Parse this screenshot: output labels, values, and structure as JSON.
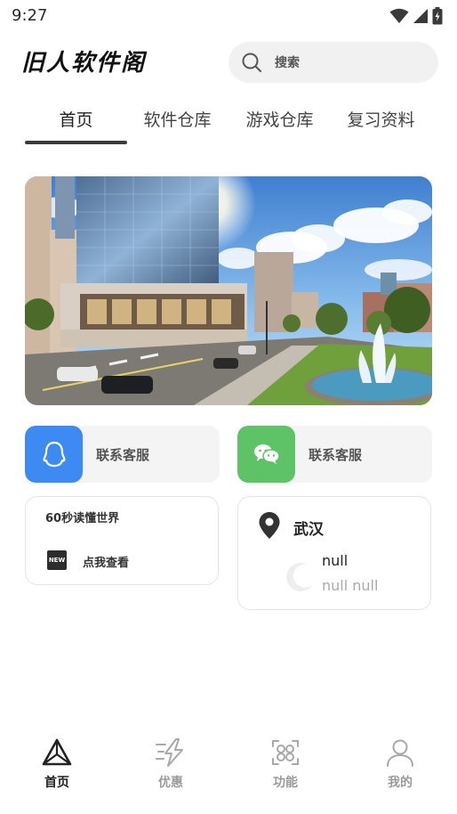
{
  "status_bar": {
    "time": "9:27",
    "icons": [
      "wifi-icon",
      "signal-icon",
      "battery-charging-icon"
    ]
  },
  "header": {
    "logo_text": "旧人软件阁",
    "search": {
      "placeholder": "搜索",
      "icon": "search-icon"
    }
  },
  "tabs": [
    {
      "label": "首页",
      "active": true
    },
    {
      "label": "软件仓库",
      "active": false
    },
    {
      "label": "游戏仓库",
      "active": false
    },
    {
      "label": "复习资料",
      "active": false
    }
  ],
  "banner": {
    "subject": "city street with glass office buildings, park and fountain"
  },
  "contact_cards": [
    {
      "label": "联系客服",
      "icon": "qq-penguin-icon",
      "color": "#3c8af2"
    },
    {
      "label": "联系客服",
      "icon": "wechat-icon",
      "color": "#5ec266"
    }
  ],
  "news_card": {
    "title": "60秒读懂世界",
    "badge": "NEW",
    "link_label": "点我查看"
  },
  "weather_card": {
    "city": "武汉",
    "temperature": "null",
    "description": "null null",
    "icons": [
      "location-pin-icon",
      "moon-icon"
    ]
  },
  "bottom_nav": [
    {
      "label": "首页",
      "icon": "home-triangle-icon",
      "active": true
    },
    {
      "label": "优惠",
      "icon": "lightning-icon",
      "active": false
    },
    {
      "label": "功能",
      "icon": "function-grid-icon",
      "active": false
    },
    {
      "label": "我的",
      "icon": "user-icon",
      "active": false
    }
  ],
  "colors": {
    "accent_dark": "#3a3a3a",
    "qq_blue": "#3c8af2",
    "wechat_green": "#5ec266",
    "inactive_gray": "#9a9a9a"
  }
}
